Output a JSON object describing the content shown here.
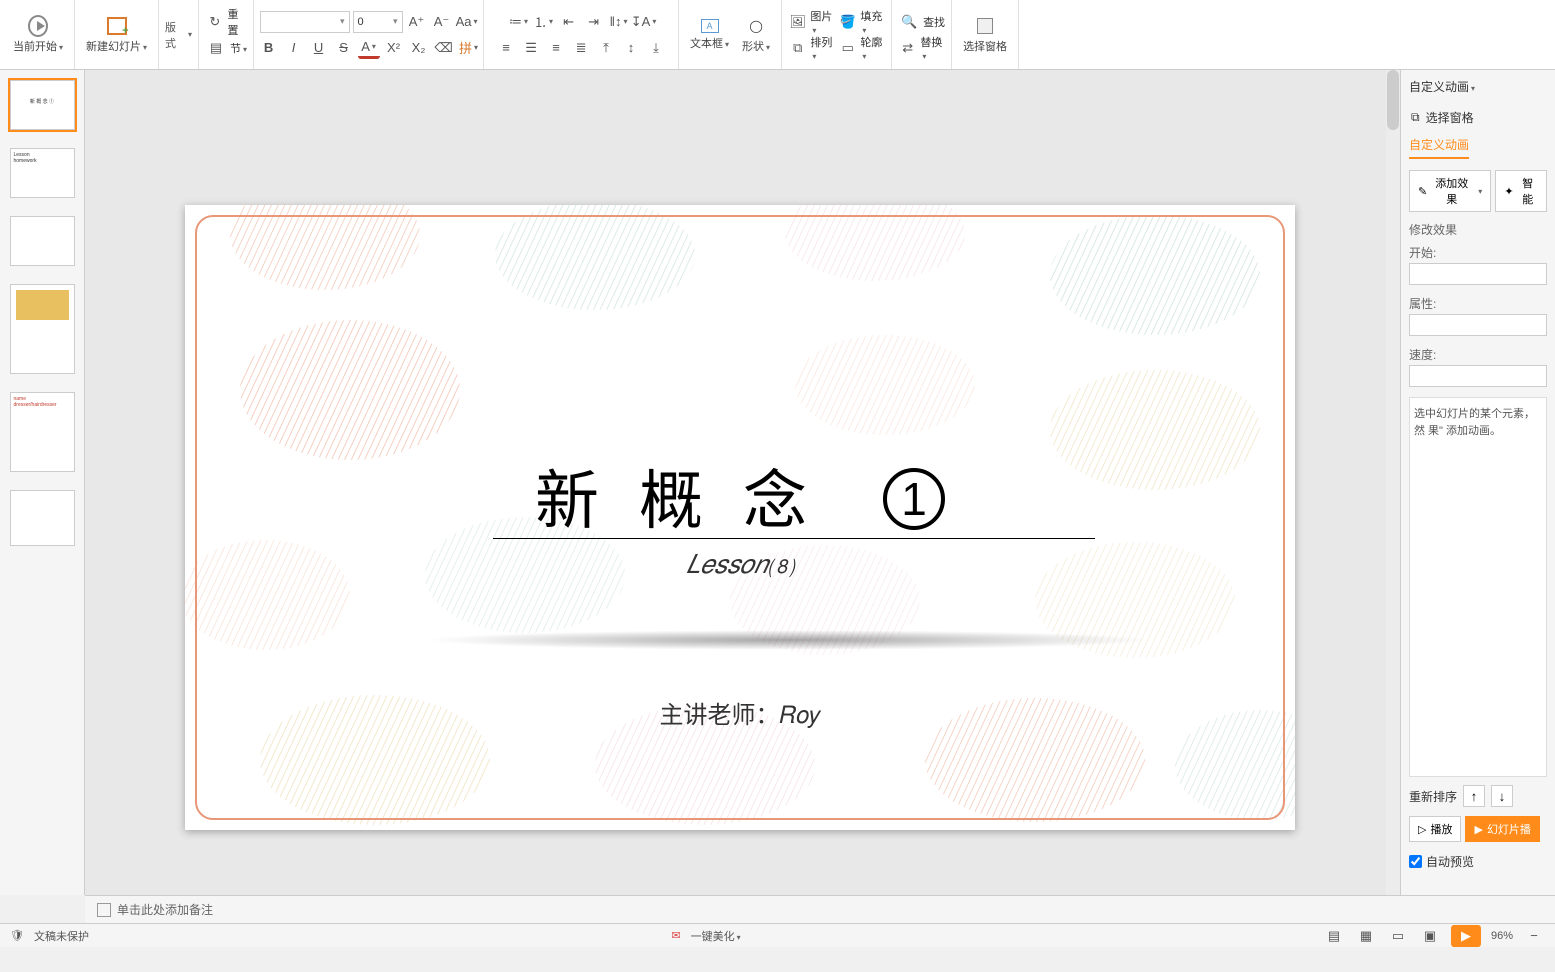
{
  "ribbon": {
    "start": "当前开始",
    "newslide": "新建幻灯片",
    "layout": "版式",
    "reset": "重置",
    "section": "节",
    "font_name": "",
    "font_size": "0",
    "textbox": "文本框",
    "shapes": "形状",
    "picture": "图片",
    "fill": "填充",
    "arrange": "排列",
    "outline": "轮廓",
    "find": "查找",
    "replace": "替换",
    "selectpane": "选择窗格"
  },
  "slide": {
    "title_chars": "新概念",
    "title_num": "1",
    "lesson": "𝐿𝑒𝑠𝑠𝑜𝑛⑻",
    "teacher": "主讲老师：𝑅𝑜𝑦"
  },
  "notes": {
    "placeholder": "单击此处添加备注"
  },
  "panel": {
    "title": "自定义动画",
    "selpane": "选择窗格",
    "anim": "自定义动画",
    "addfx": "添加效果",
    "smart": "智能",
    "modify": "修改效果",
    "start": "开始:",
    "prop": "属性:",
    "speed": "速度:",
    "hint": "选中幻灯片的某个元素，然\n果\" 添加动画。",
    "reorder": "重新排序",
    "play": "播放",
    "slideshow": "幻灯片播",
    "autoprev": "自动预览"
  },
  "status": {
    "protect": "文稿未保护",
    "beautify": "一键美化",
    "zoom": "96%"
  },
  "colors": {
    "coral": "#e89878",
    "teal": "#9bc4bd",
    "mustard": "#e0c888",
    "pink": "#e8b8c0"
  }
}
